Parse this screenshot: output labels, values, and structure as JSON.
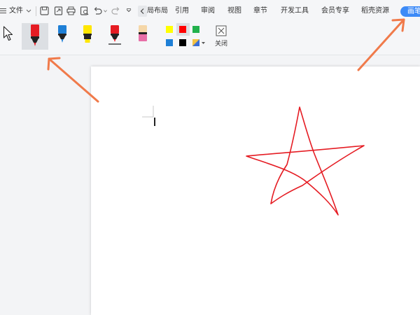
{
  "menu": {
    "file_label": "文件",
    "tabs": [
      "局布局",
      "引用",
      "审阅",
      "视图",
      "章节",
      "开发工具",
      "会员专享",
      "稻壳资源"
    ],
    "active_tab": "画笔"
  },
  "ribbon": {
    "close_label": "关闭",
    "pens": [
      "red",
      "blue",
      "yellow",
      "red-thin",
      "pink-eraser"
    ],
    "palette": [
      "#ffff00",
      "#ff0000",
      "#22b14c",
      "#1e7fd6",
      "#000000",
      "rainbow"
    ]
  },
  "colors": {
    "accent": "#3c8af7",
    "ink": "#e51c23",
    "arrow": "#f07a4a"
  },
  "icons": [
    "menu-icon",
    "chevron-down-icon",
    "save-icon",
    "export-icon",
    "print-icon",
    "preview-icon",
    "undo-icon",
    "redo-icon",
    "more-icon",
    "chevron-left-icon",
    "cursor-icon",
    "close-icon"
  ]
}
